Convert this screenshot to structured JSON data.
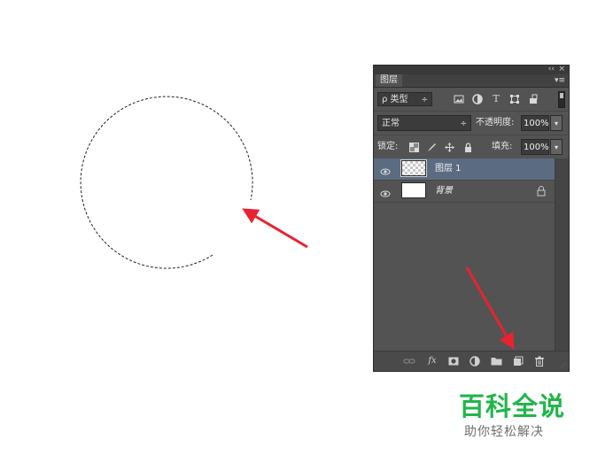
{
  "panel": {
    "collapse_glyph": "‹‹",
    "close_glyph": "×",
    "tab_label": "图层",
    "menu_glyph": "▾≡",
    "filter": {
      "search_glyph": "ρ",
      "selected": "类型",
      "arrow": "÷",
      "icons": [
        "image-filter-icon",
        "adjustment-filter-icon",
        "type-filter-icon",
        "shape-filter-icon",
        "smart-object-filter-icon"
      ],
      "type_glyph": "T"
    },
    "blend": {
      "mode": "正常",
      "arrow": "÷",
      "opacity_label": "不透明度:",
      "opacity_value": "100%"
    },
    "lock": {
      "label": "锁定:",
      "fill_label": "填充:",
      "fill_value": "100%"
    },
    "dropdown_glyph": "▾",
    "layers": [
      {
        "name": "图层 1",
        "selected": true,
        "thumbnail": "transparent",
        "locked": false
      },
      {
        "name": "背景",
        "selected": false,
        "thumbnail": "white",
        "locked": true
      }
    ],
    "bottom_icons": [
      "link-icon",
      "fx-icon",
      "mask-icon",
      "adjustment-icon",
      "folder-icon",
      "new-layer-icon",
      "trash-icon"
    ],
    "fx_label": "fx"
  },
  "watermark": {
    "title": "百科全说",
    "subtitle": "助你轻松解决"
  },
  "colors": {
    "panel_bg": "#535353",
    "selected_layer": "#5b6c82",
    "arrow": "#e8232f",
    "brand_green": "#21b64a"
  }
}
